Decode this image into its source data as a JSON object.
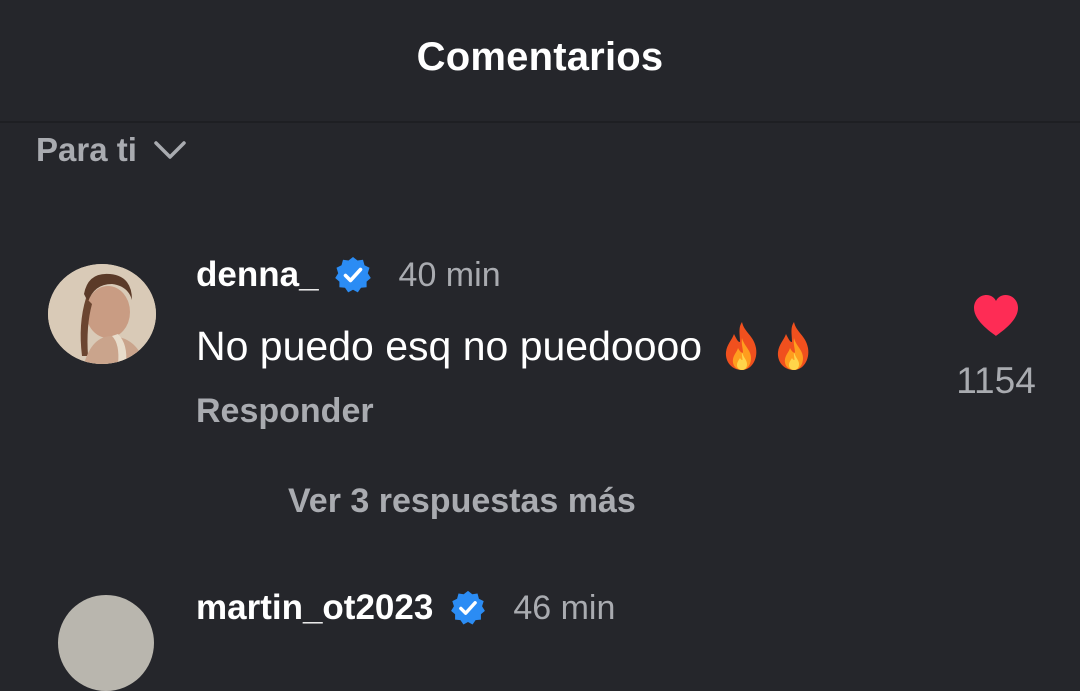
{
  "header": {
    "title": "Comentarios"
  },
  "sort": {
    "label": "Para ti",
    "icon": "chevron-down-icon"
  },
  "comments": [
    {
      "username": "denna_",
      "verified": true,
      "time": "40 min",
      "text": "No puedo esq no puedoooo",
      "emoji": [
        "fire",
        "fire"
      ],
      "reply_label": "Responder",
      "likes": "1154",
      "liked": true
    },
    {
      "username": "martin_ot2023",
      "verified": true,
      "time": "46 min"
    }
  ],
  "more_replies": "Ver 3 respuestas más",
  "colors": {
    "background": "#25262b",
    "muted_text": "#a9abb0",
    "verified_blue": "#2b8cf4",
    "like_red": "#fe2c55"
  }
}
